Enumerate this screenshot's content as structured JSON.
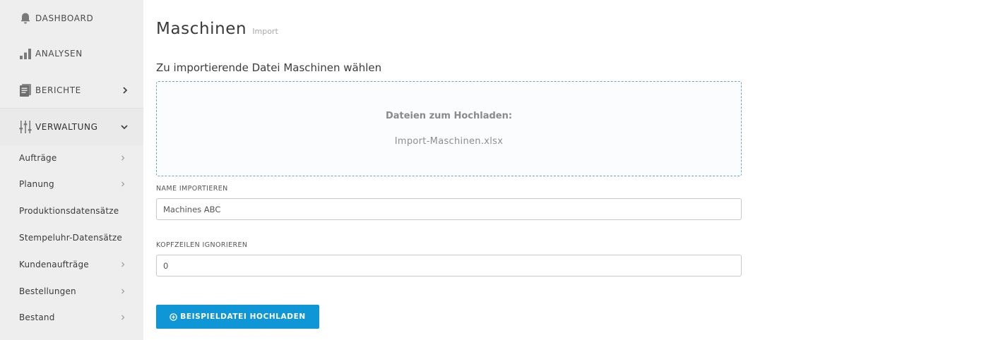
{
  "sidebar": {
    "top_items": [
      {
        "label": "DASHBOARD",
        "icon": "bell-icon"
      },
      {
        "label": "ANALYSEN",
        "icon": "bar-chart-icon"
      },
      {
        "label": "BERICHTE",
        "icon": "reports-icon",
        "chevron": "chevron-right-icon"
      },
      {
        "label": "VERWALTUNG",
        "icon": "sliders-icon",
        "chevron": "chevron-down-icon",
        "expanded": true
      }
    ],
    "sub_items": [
      {
        "label": "Aufträge",
        "has_chevron": true
      },
      {
        "label": "Planung",
        "has_chevron": true
      },
      {
        "label": "Produktionsdatensätze",
        "has_chevron": false
      },
      {
        "label": "Stempeluhr-Datensätze",
        "has_chevron": false
      },
      {
        "label": "Kundenaufträge",
        "has_chevron": true
      },
      {
        "label": "Bestellungen",
        "has_chevron": true
      },
      {
        "label": "Bestand",
        "has_chevron": true
      }
    ]
  },
  "main": {
    "title": "Maschinen",
    "subtitle": "Import",
    "file_section_label": "Zu importierende Datei Maschinen wählen",
    "dropzone": {
      "heading": "Dateien zum Hochladen:",
      "filename": "Import-Maschinen.xlsx"
    },
    "name_field": {
      "label": "NAME IMPORTIEREN",
      "value": "Machines ABC"
    },
    "header_field": {
      "label": "KOPFZEILEN IGNORIEREN",
      "value": "0"
    },
    "upload_button": {
      "label": "BEISPIELDATEI HOCHLADEN",
      "icon": "plus-circle-icon"
    }
  },
  "colors": {
    "sidebar_bg": "#eeeeee",
    "accent": "#0e96d6",
    "dropzone_border": "#6aa6c2"
  }
}
